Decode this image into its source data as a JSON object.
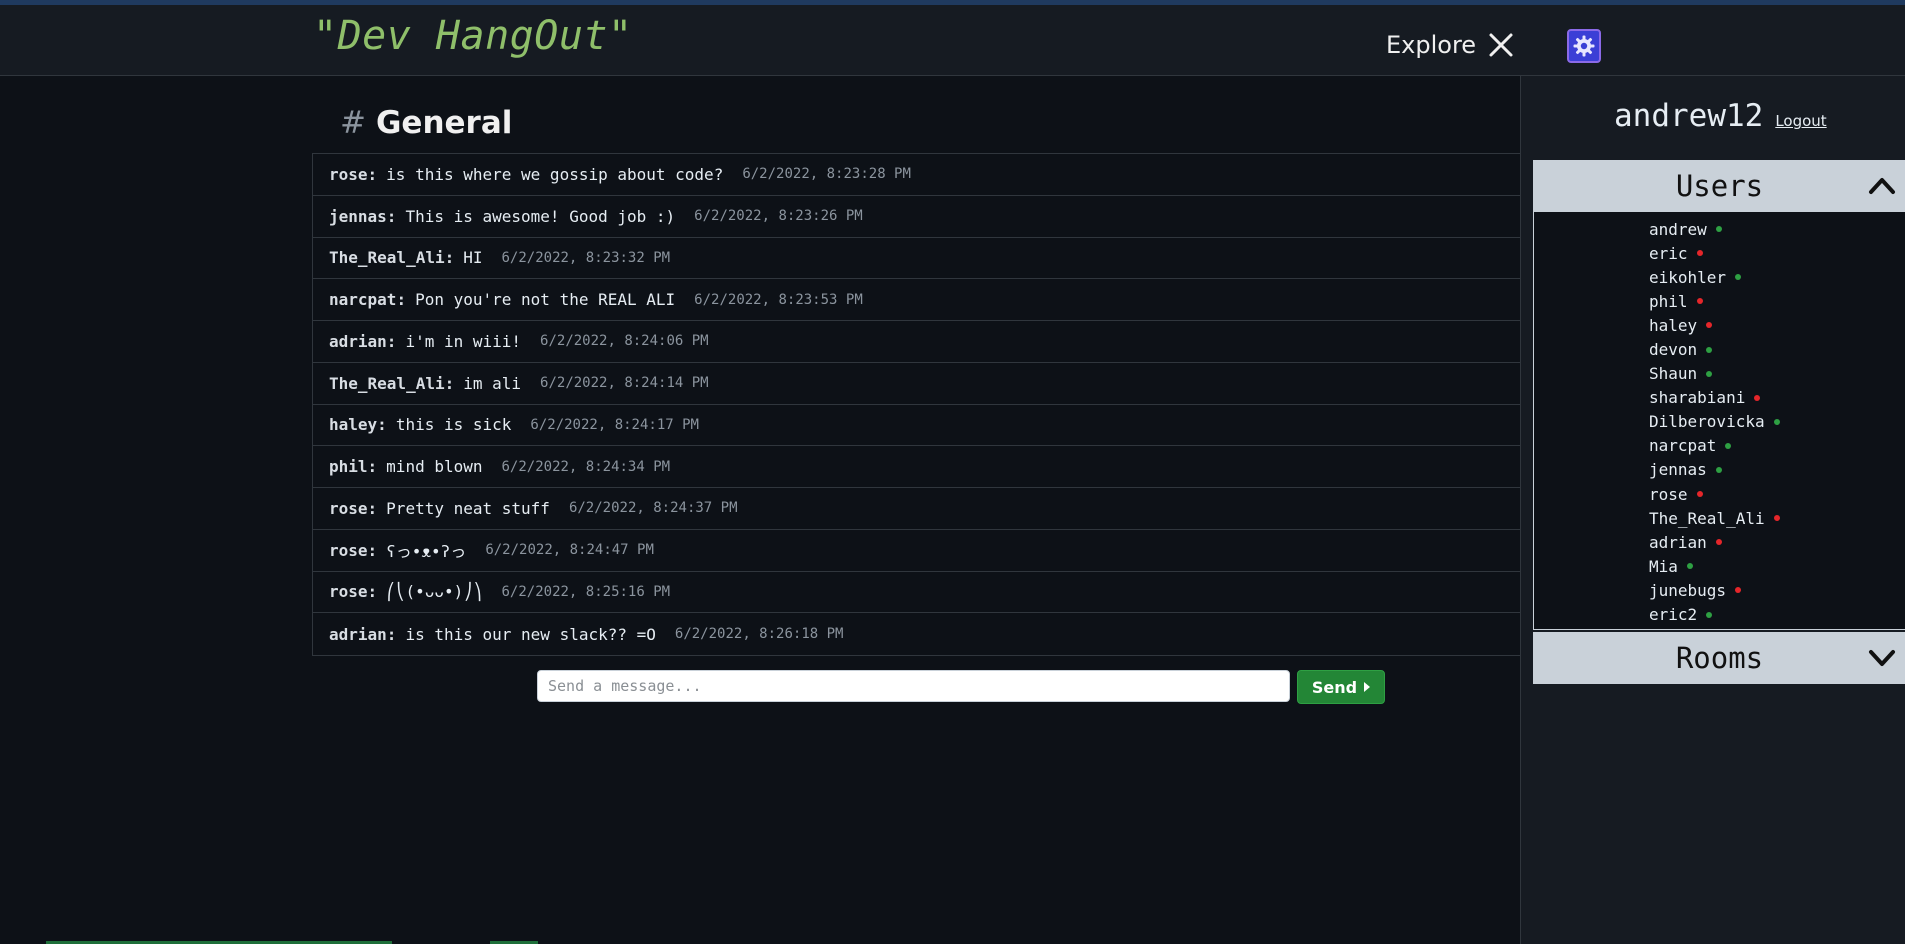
{
  "header": {
    "app_title": "\"Dev HangOut\"",
    "explore_label": "Explore",
    "settings_icon": "gear-icon",
    "close_icon": "close-icon"
  },
  "channel": {
    "hash": "#",
    "name": "General"
  },
  "messages": [
    {
      "user": "rose",
      "text": "is this where we gossip about code?",
      "time": "6/2/2022, 8:23:28 PM"
    },
    {
      "user": "jennas",
      "text": "This is awesome! Good job :)",
      "time": "6/2/2022, 8:23:26 PM"
    },
    {
      "user": "The_Real_Ali",
      "text": "HI",
      "time": "6/2/2022, 8:23:32 PM"
    },
    {
      "user": "narcpat",
      "text": "Pon you're not the REAL ALI",
      "time": "6/2/2022, 8:23:53 PM"
    },
    {
      "user": "adrian",
      "text": "i'm in wiii!",
      "time": "6/2/2022, 8:24:06 PM"
    },
    {
      "user": "The_Real_Ali",
      "text": "im ali",
      "time": "6/2/2022, 8:24:14 PM"
    },
    {
      "user": "haley",
      "text": "this is sick",
      "time": "6/2/2022, 8:24:17 PM"
    },
    {
      "user": "phil",
      "text": "mind blown",
      "time": "6/2/2022, 8:24:34 PM"
    },
    {
      "user": "rose",
      "text": "Pretty neat stuff",
      "time": "6/2/2022, 8:24:37 PM"
    },
    {
      "user": "rose",
      "text": "ʕっ•ᴥ•ʔっ",
      "time": "6/2/2022, 8:24:47 PM"
    },
    {
      "user": "rose",
      "text": "⎛⎝(•ᴗᴗ•)⎠⎞",
      "time": "6/2/2022, 8:25:16 PM"
    },
    {
      "user": "adrian",
      "text": "is this our new slack?? =O",
      "time": "6/2/2022, 8:26:18 PM"
    }
  ],
  "composer": {
    "placeholder": "Send a message...",
    "value": "",
    "send_label": "Send"
  },
  "sidebar": {
    "current_user": "andrew12",
    "logout_label": "Logout",
    "users_title": "Users",
    "rooms_title": "Rooms",
    "users": [
      {
        "name": "andrew",
        "online": true
      },
      {
        "name": "eric",
        "online": false
      },
      {
        "name": "eikohler",
        "online": true
      },
      {
        "name": "phil",
        "online": false
      },
      {
        "name": "haley",
        "online": false
      },
      {
        "name": "devon",
        "online": true
      },
      {
        "name": "Shaun",
        "online": true
      },
      {
        "name": "sharabiani",
        "online": false
      },
      {
        "name": "Dilberovicka",
        "online": true
      },
      {
        "name": "narcpat",
        "online": true
      },
      {
        "name": "jennas",
        "online": true
      },
      {
        "name": "rose",
        "online": false
      },
      {
        "name": "The_Real_Ali",
        "online": false
      },
      {
        "name": "adrian",
        "online": false
      },
      {
        "name": "Mia",
        "online": true
      },
      {
        "name": "junebugs",
        "online": false
      },
      {
        "name": "eric2",
        "online": true
      }
    ]
  },
  "colors": {
    "online": "#2ea043",
    "offline": "#e5262a",
    "accent_green": "#238636",
    "title_green": "#8fbf6a"
  }
}
